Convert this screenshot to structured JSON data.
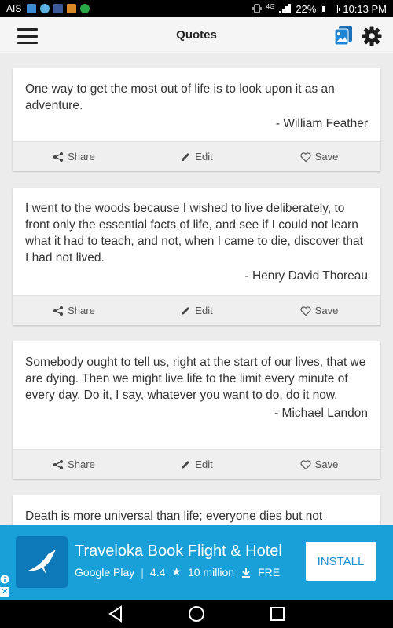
{
  "statusbar": {
    "carrier": "AIS",
    "notification_icons": [
      {
        "name": "messages-icon",
        "color": "#3a8bd1"
      },
      {
        "name": "chat-icon",
        "color": "#5ab0e0"
      },
      {
        "name": "facebook-icon",
        "color": "#3b5998"
      },
      {
        "name": "mail-icon",
        "color": "#d68a27"
      },
      {
        "name": "line-icon",
        "color": "#28a745"
      }
    ],
    "network": "4G",
    "battery": "22%",
    "time": "10:13 PM"
  },
  "appbar": {
    "title": "Quotes"
  },
  "actions": {
    "share": "Share",
    "edit": "Edit",
    "save": "Save"
  },
  "quotes": [
    {
      "text": "One way to get the most out of life is to look upon it as an adventure.",
      "author": "- William Feather"
    },
    {
      "text": "I went to the woods because I wished to live deliberately, to front only the essential facts of life, and see if I could not learn what it had to teach, and not, when I came to die, discover that I had not lived.",
      "author": "- Henry David Thoreau"
    },
    {
      "text": "Somebody ought to tell us, right at the start of our lives, that we are dying. Then we might live life to the limit every minute of every day. Do it, I say, whatever you want to do, do it now.",
      "author": "- Michael Landon"
    },
    {
      "text": "Death is more universal than life; everyone dies but not",
      "author": ""
    }
  ],
  "ad": {
    "title": "Traveloka Book Flight & Hotel",
    "store": "Google Play",
    "rating": "4.4",
    "downloads": "10 million",
    "price": "FRE",
    "install": "INSTALL",
    "bg_color": "#1aa0d8"
  }
}
